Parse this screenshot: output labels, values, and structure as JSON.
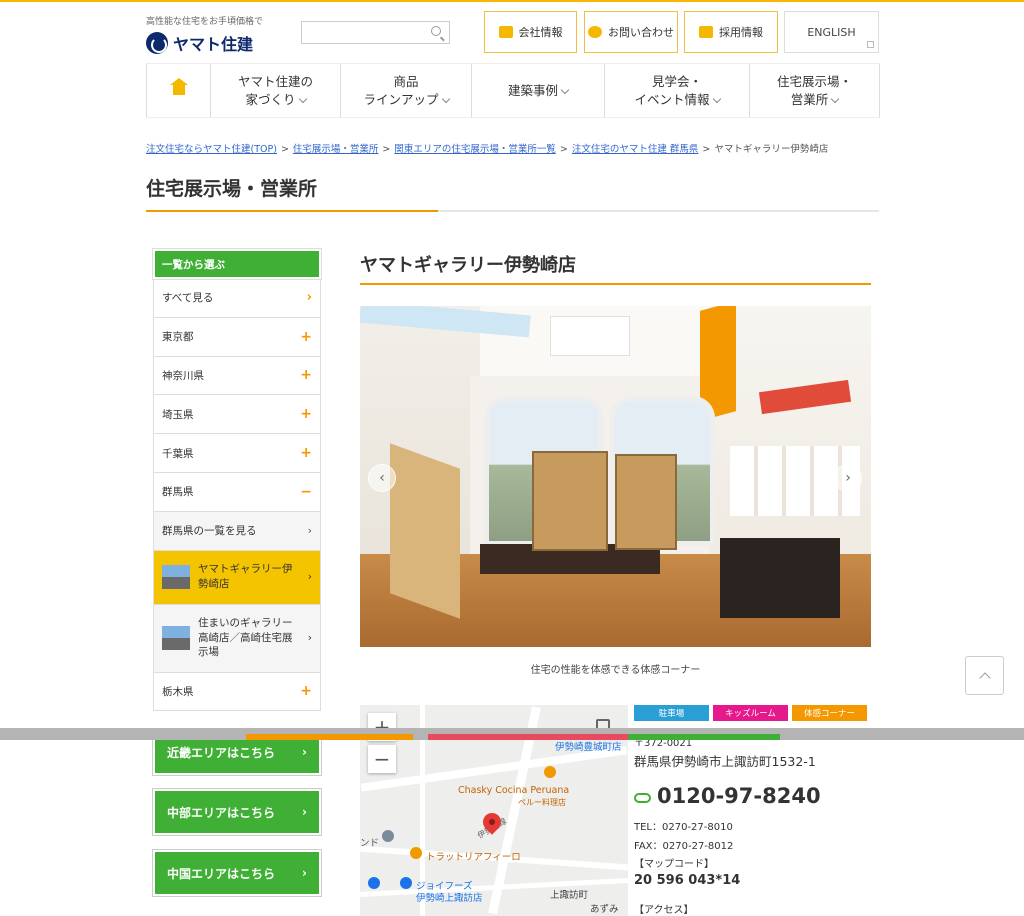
{
  "header": {
    "tagline": "高性能な住宅をお手頃価格で",
    "logo": "ヤマト住建",
    "search_placeholder": "",
    "buttons": [
      {
        "label": "会社情報"
      },
      {
        "label": "お問い合わせ"
      },
      {
        "label": "採用情報"
      },
      {
        "label": "ENGLISH"
      }
    ]
  },
  "nav": [
    {
      "line1": "ヤマト住建の",
      "line2": "家づくり"
    },
    {
      "line1": "商品",
      "line2": "ラインアップ"
    },
    {
      "line1": "建築事例",
      "line2": ""
    },
    {
      "line1": "見学会・",
      "line2": "イベント情報"
    },
    {
      "line1": "住宅展示場・",
      "line2": "営業所"
    }
  ],
  "breadcrumb": {
    "items": [
      "注文住宅ならヤマト住建(TOP)",
      "住宅展示場・営業所",
      "関東エリアの住宅展示場・営業所一覧",
      "注文住宅のヤマト住建 群馬県"
    ],
    "separator": ">",
    "current": "ヤマトギャラリー伊勢崎店"
  },
  "page_title": "住宅展示場・営業所",
  "sidebar": {
    "heading": "一覧から選ぶ",
    "items": [
      {
        "label": "すべて見る",
        "mark": "›"
      },
      {
        "label": "東京都",
        "mark": "+"
      },
      {
        "label": "神奈川県",
        "mark": "+"
      },
      {
        "label": "埼玉県",
        "mark": "+"
      },
      {
        "label": "千葉県",
        "mark": "+"
      },
      {
        "label": "群馬県",
        "mark": "−"
      }
    ],
    "sub_all": {
      "label": "群馬県の一覧を見る",
      "mark": "›"
    },
    "stores": [
      {
        "label": "ヤマトギャラリー伊勢崎店",
        "mark": "›"
      },
      {
        "label": "住まいのギャラリー高崎店／高崎住宅展示場",
        "mark": "›"
      }
    ],
    "last_item": {
      "label": "栃木県",
      "mark": "+"
    },
    "area_buttons": [
      {
        "label": "近畿エリアはこちら",
        "mark": "›"
      },
      {
        "label": "中部エリアはこちら",
        "mark": "›"
      },
      {
        "label": "中国エリアはこちら",
        "mark": "›"
      }
    ]
  },
  "store": {
    "title": "ヤマトギャラリー伊勢崎店",
    "photo_caption": "住宅の性能を体感できる体感コーナー",
    "tags": [
      {
        "label": "駐車場",
        "color": "#2a9fd6"
      },
      {
        "label": "キッズルーム",
        "color": "#e6198c"
      },
      {
        "label": "体感コーナー",
        "color": "#f39800"
      }
    ],
    "postal_partial": "〒372-0021",
    "address": "群馬県伊勢崎市上諏訪町1532-1",
    "free_dial": "0120-97-8240",
    "tel": "TEL：0270-27-8010",
    "fax": "FAX：0270-27-8012",
    "mapcode_label": "【マップコード】",
    "mapcode": "20 596 043*14",
    "access_label": "【アクセス】"
  },
  "map": {
    "zoom_in": "+",
    "zoom_out": "−",
    "labels": [
      "伊勢崎豊城町店",
      "Chasky Cocina Peruana",
      "ペルー料理店",
      "トラットリアフィーロ",
      "ジョイフーズ",
      "伊勢崎上諏訪店",
      "上諏訪町",
      "あずみ",
      "ンド",
      "伊勢崎線"
    ]
  }
}
